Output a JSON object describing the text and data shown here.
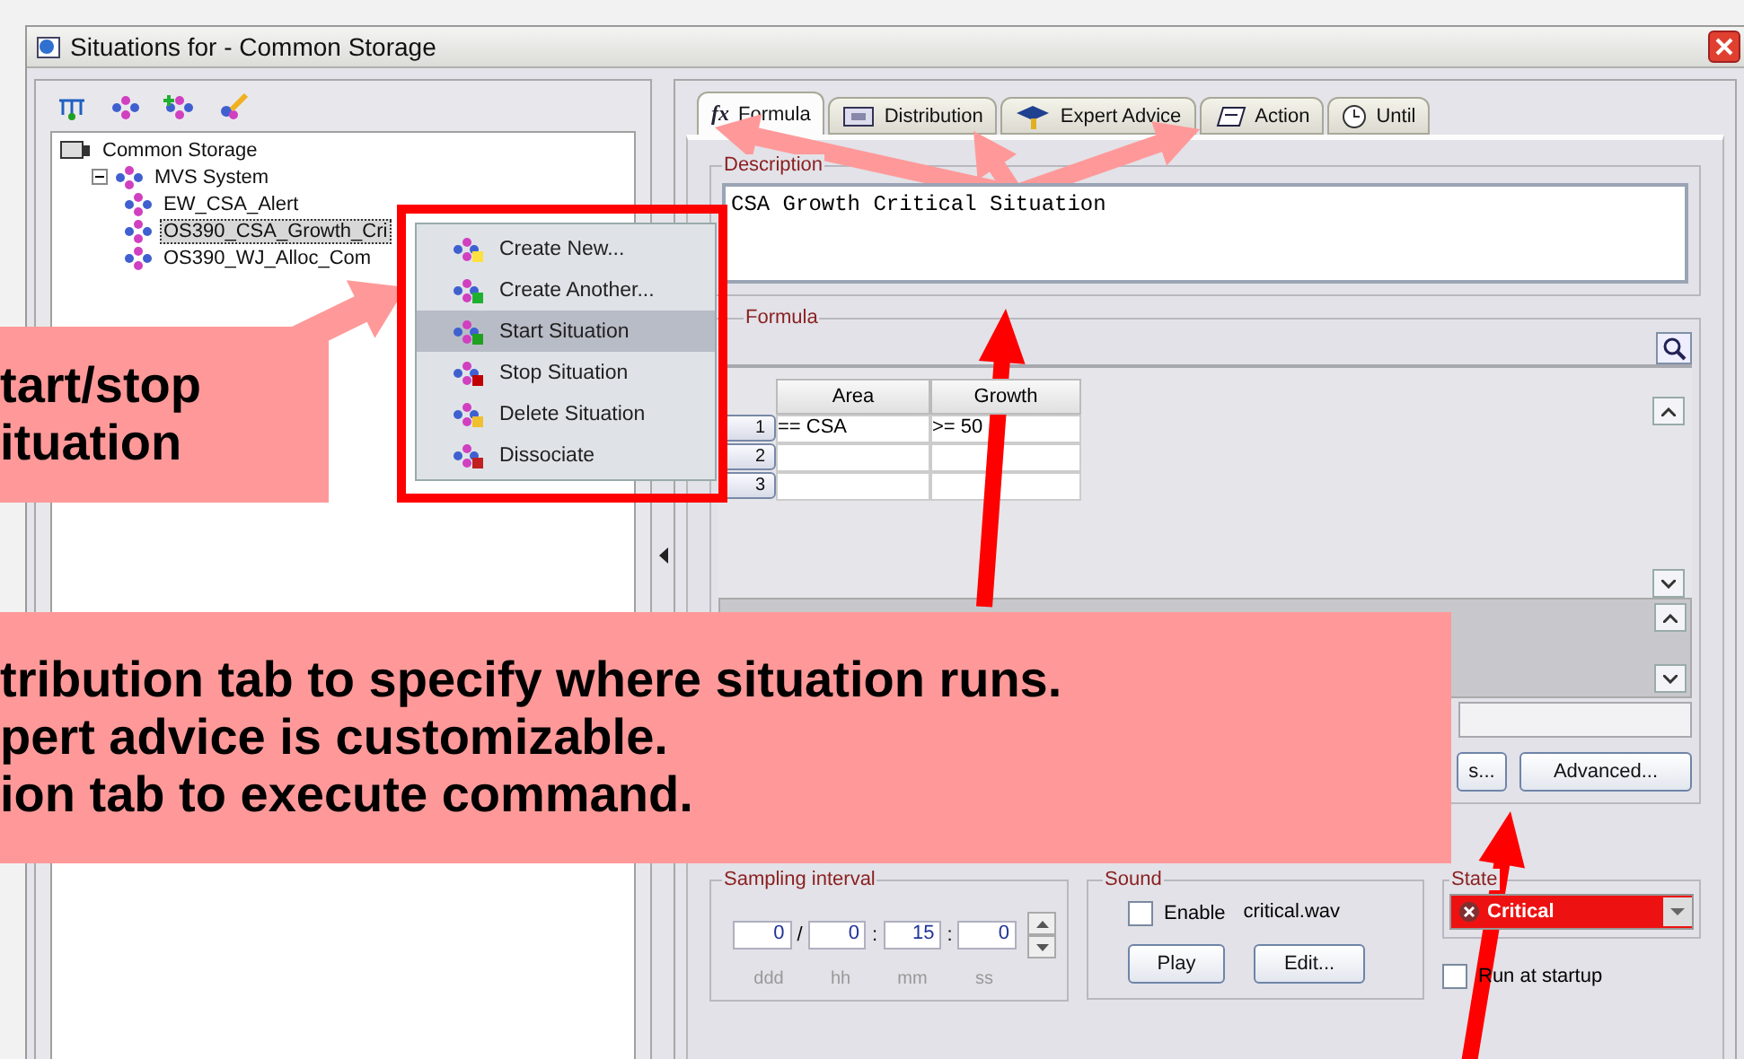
{
  "window": {
    "title": "Situations for - Common Storage"
  },
  "tree": {
    "label": "Common Storage",
    "children": [
      {
        "label": "MVS System",
        "expanded": true,
        "children": [
          {
            "label": "EW_CSA_Alert",
            "selected": false
          },
          {
            "label": "OS390_CSA_Growth_Cri",
            "selected": true
          },
          {
            "label": "OS390_WJ_Alloc_Com",
            "selected": false
          }
        ]
      }
    ]
  },
  "context_menu": [
    {
      "label": "Create New...",
      "selected": false
    },
    {
      "label": "Create Another...",
      "selected": false
    },
    {
      "label": "Start Situation",
      "selected": true
    },
    {
      "label": "Stop Situation",
      "selected": false
    },
    {
      "label": "Delete Situation",
      "selected": false
    },
    {
      "label": "Dissociate",
      "selected": false
    }
  ],
  "tabs": [
    {
      "label": "Formula",
      "glyph": "fx",
      "selected": true
    },
    {
      "label": "Distribution",
      "selected": false
    },
    {
      "label": "Expert Advice",
      "selected": false
    },
    {
      "label": "Action",
      "selected": false
    },
    {
      "label": "Until",
      "selected": false
    }
  ],
  "description": {
    "label": "Description",
    "value": "CSA Growth Critical Situation"
  },
  "formula": {
    "label": "Formula",
    "columns": [
      "Area",
      "Growth"
    ],
    "rows": [
      {
        "number": "1",
        "cells": [
          "== CSA",
          ">= 50"
        ]
      },
      {
        "number": "2"
      },
      {
        "number": "3"
      }
    ]
  },
  "formula_buttons": [
    "s...",
    "Advanced..."
  ],
  "sampling": {
    "label": "Sampling interval",
    "fields": [
      {
        "value": "0",
        "unit": "ddd"
      },
      {
        "value": "0",
        "unit": "hh"
      },
      {
        "value": "15",
        "unit": "mm"
      },
      {
        "value": "0",
        "unit": "ss"
      }
    ],
    "separators": [
      "/",
      ":",
      ":"
    ]
  },
  "sound": {
    "label": "Sound",
    "enable": {
      "label": "Enable",
      "checked": false
    },
    "file": "critical.wav",
    "buttons": [
      "Play",
      "Edit..."
    ]
  },
  "state": {
    "label": "State",
    "value": "Critical"
  },
  "run_at_startup": {
    "label": "Run at startup",
    "checked": false
  },
  "callouts": [
    {
      "lines": [
        "tart/stop",
        "ituation"
      ]
    },
    {
      "lines": [
        "tribution tab to specify where situation runs.",
        "pert advice is customizable.",
        "ion tab to execute command."
      ]
    }
  ]
}
